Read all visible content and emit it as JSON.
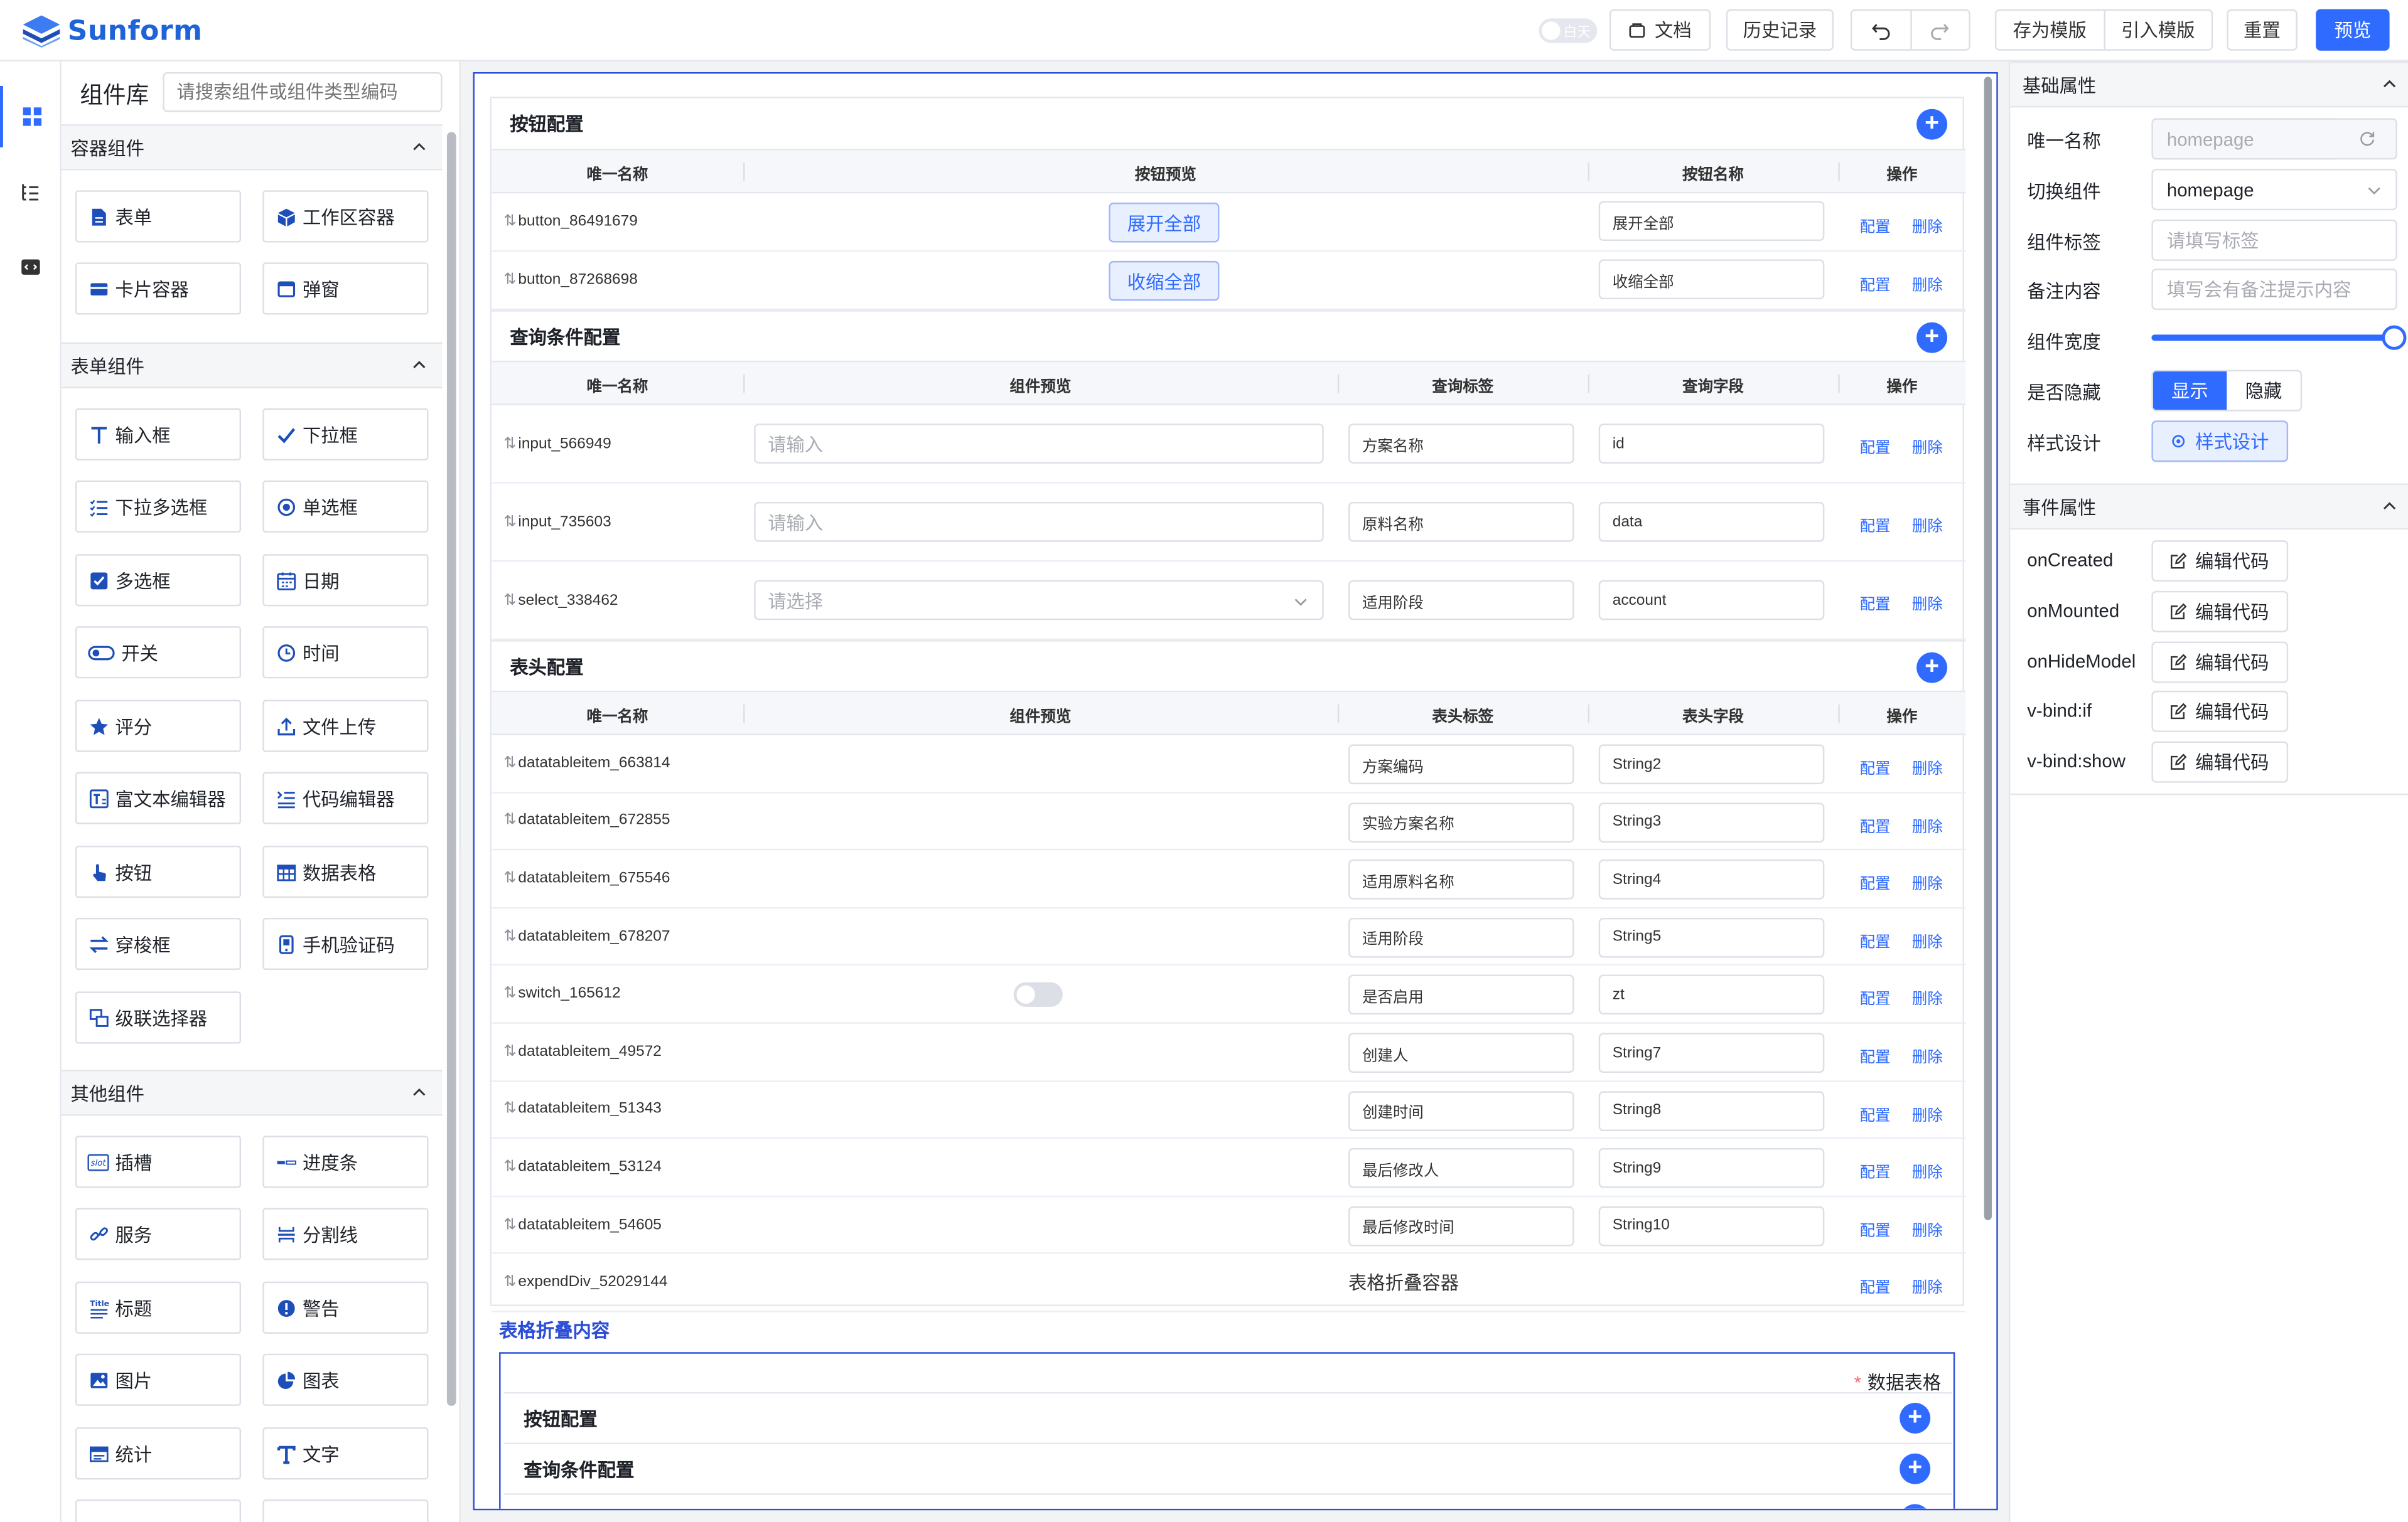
{
  "header": {
    "logo_text": "Sunform",
    "theme_toggle_label": "白天",
    "docs_label": "文档",
    "history_label": "历史记录",
    "save_template_label": "存为模版",
    "import_template_label": "引入模版",
    "reset_label": "重置",
    "preview_label": "预览"
  },
  "library": {
    "title": "组件库",
    "search_placeholder": "请搜索组件或组件类型编码",
    "groups": [
      {
        "title": "容器组件",
        "items": [
          "表单",
          "工作区容器",
          "卡片容器",
          "弹窗"
        ]
      },
      {
        "title": "表单组件",
        "items": [
          "输入框",
          "下拉框",
          "下拉多选框",
          "单选框",
          "多选框",
          "日期",
          "开关",
          "时间",
          "评分",
          "文件上传",
          "富文本编辑器",
          "代码编辑器",
          "按钮",
          "数据表格",
          "穿梭框",
          "手机验证码",
          "级联选择器"
        ]
      },
      {
        "title": "其他组件",
        "items": [
          "插槽",
          "进度条",
          "服务",
          "分割线",
          "标题",
          "警告",
          "图片",
          "图表",
          "统计",
          "文字"
        ]
      }
    ]
  },
  "canvas": {
    "button_section": {
      "title": "按钮配置",
      "columns": [
        "唯一名称",
        "按钮预览",
        "按钮名称",
        "操作"
      ],
      "rows": [
        {
          "name": "button_86491679",
          "preview": "展开全部",
          "label": "展开全部"
        },
        {
          "name": "button_87268698",
          "preview": "收缩全部",
          "label": "收缩全部"
        }
      ]
    },
    "query_section": {
      "title": "查询条件配置",
      "columns": [
        "唯一名称",
        "组件预览",
        "查询标签",
        "查询字段",
        "操作"
      ],
      "rows": [
        {
          "name": "input_566949",
          "preview": "请输入",
          "label": "方案名称",
          "field": "id"
        },
        {
          "name": "input_735603",
          "preview": "请输入",
          "label": "原料名称",
          "field": "data"
        },
        {
          "name": "select_338462",
          "preview": "请选择",
          "label": "适用阶段",
          "field": "account"
        }
      ]
    },
    "header_section": {
      "title": "表头配置",
      "columns": [
        "唯一名称",
        "组件预览",
        "表头标签",
        "表头字段",
        "操作"
      ],
      "rows": [
        {
          "name": "datatableitem_663814",
          "label": "方案编码",
          "field": "String2"
        },
        {
          "name": "datatableitem_672855",
          "label": "实验方案名称",
          "field": "String3"
        },
        {
          "name": "datatableitem_675546",
          "label": "适用原料名称",
          "field": "String4"
        },
        {
          "name": "datatableitem_678207",
          "label": "适用阶段",
          "field": "String5"
        },
        {
          "name": "switch_165612",
          "label": "是否启用",
          "field": "zt"
        },
        {
          "name": "datatableitem_49572",
          "label": "创建人",
          "field": "String7"
        },
        {
          "name": "datatableitem_51343",
          "label": "创建时间",
          "field": "String8"
        },
        {
          "name": "datatableitem_53124",
          "label": "最后修改人",
          "field": "String9"
        },
        {
          "name": "datatableitem_54605",
          "label": "最后修改时间",
          "field": "String10"
        }
      ],
      "expand_row": {
        "name": "expendDiv_52029144",
        "label": "表格折叠容器"
      }
    },
    "op_config": "配置",
    "op_delete": "删除",
    "plus_symbol": "+",
    "drag_symbol": "⇅",
    "nested": {
      "title": "表格折叠内容",
      "required_mark": "*",
      "label": "数据表格",
      "rows": [
        "按钮配置",
        "查询条件配置"
      ]
    }
  },
  "props": {
    "basic_title": "基础属性",
    "unique_name_label": "唯一名称",
    "unique_name_value": "homepage",
    "switch_component_label": "切换组件",
    "switch_component_value": "homepage",
    "tag_label": "组件标签",
    "tag_placeholder": "请填写标签",
    "remark_label": "备注内容",
    "remark_placeholder": "填写会有备注提示内容",
    "width_label": "组件宽度",
    "width_percent": 100,
    "hidden_label": "是否隐藏",
    "show_label": "显示",
    "hide_label": "隐藏",
    "style_label": "样式设计",
    "style_button": "样式设计",
    "events_title": "事件属性",
    "events": [
      "onCreated",
      "onMounted",
      "onHideModel",
      "v-bind:if",
      "v-bind:show"
    ],
    "edit_code_label": "编辑代码"
  },
  "colors": {
    "primary": "#2f6bff",
    "canvas_border": "#2d4fd7",
    "logo": "#1e63d8"
  }
}
